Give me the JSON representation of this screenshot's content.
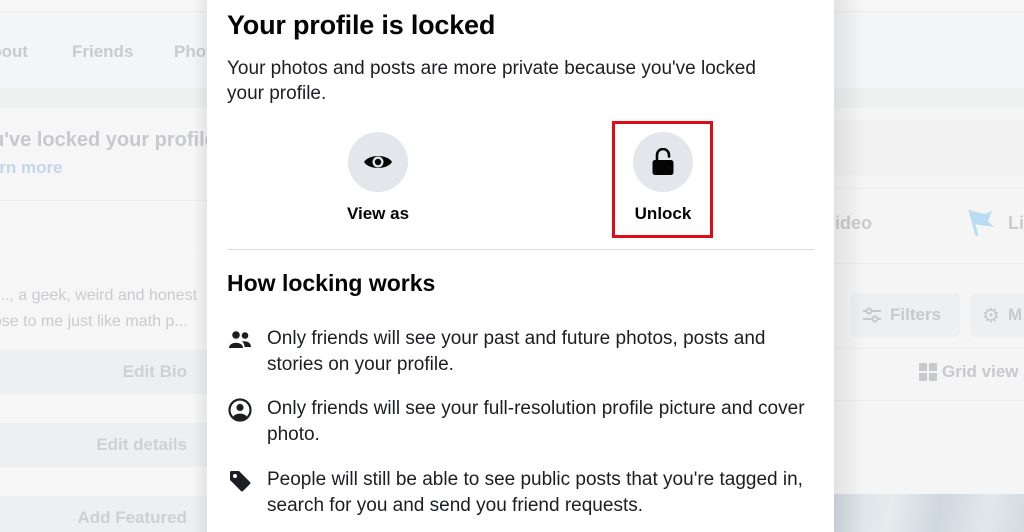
{
  "background": {
    "profile_tabs": [
      "About",
      "Friends",
      "Photos"
    ],
    "locked_notice": "You've locked your profile",
    "learn_more": "Learn more",
    "bio_lines": [
      "..., a geek, weird and honest",
      "...close to me just like math p..."
    ],
    "buttons": [
      "Edit Bio",
      "Edit details",
      "Add Featured"
    ],
    "post_actions": [
      "Live video",
      "Life event"
    ],
    "video_label": "ideo",
    "life_label": "Li",
    "filters_label": "Filters",
    "manage_label": "M",
    "grid_view_label": "Grid view"
  },
  "modal": {
    "title": "Your profile is locked",
    "subtitle": "Your photos and posts are more private because you've locked your profile.",
    "actions": [
      {
        "label": "View as",
        "icon": "eye-icon"
      },
      {
        "label": "Unlock",
        "icon": "unlock-icon",
        "highlighted": true
      }
    ],
    "highlight_color": "#e10a17",
    "how_title": "How locking works",
    "items": [
      {
        "icon": "friends-icon",
        "text": "Only friends will see your past and future photos, posts and stories on your profile."
      },
      {
        "icon": "profile-picture-icon",
        "text": "Only friends will see your full-resolution profile picture and cover photo."
      },
      {
        "icon": "tag-icon",
        "text": "People will still be able to see public posts that you're tagged in, search for you and send you friend requests."
      }
    ]
  }
}
